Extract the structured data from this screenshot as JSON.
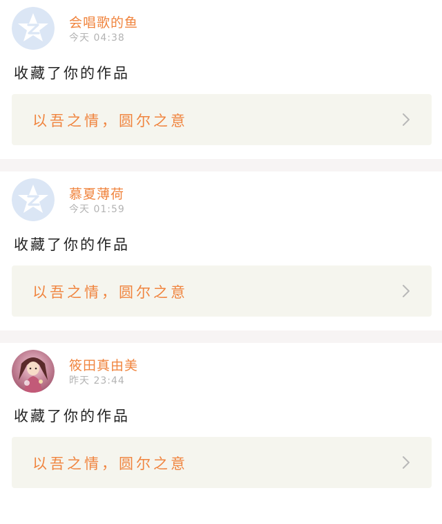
{
  "colors": {
    "accent": "#f0843e",
    "card_bg": "#f5f5ee",
    "separator": "#f7f4f4",
    "meta_text": "#b3b3b3"
  },
  "items": [
    {
      "user": "会唱歌的鱼",
      "time": "今天 04:38",
      "action": "收藏了你的作品",
      "work_title": "以吾之情，圆尔之意",
      "avatar": "qzone-default-star-avatar"
    },
    {
      "user": "慕夏薄荷",
      "time": "今天 01:59",
      "action": "收藏了你的作品",
      "work_title": "以吾之情，圆尔之意",
      "avatar": "qzone-default-star-avatar"
    },
    {
      "user": "筱田真由美",
      "time": "昨天 23:44",
      "action": "收藏了你的作品",
      "work_title": "以吾之情，圆尔之意",
      "avatar": "anime-girl-avatar"
    }
  ]
}
